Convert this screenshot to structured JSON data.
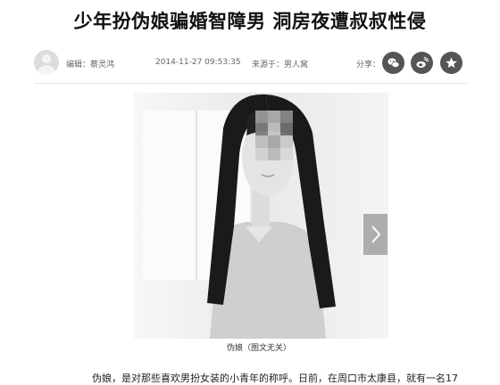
{
  "article": {
    "title": "少年扮伪娘骗婚智障男 洞房夜遭叔叔性侵",
    "editor": "编辑：蔡灵鸿",
    "datetime": "2014-11-27 09:53:35",
    "source": "来源于：男人窝",
    "share_label": "分享：",
    "share_buttons": [
      "wechat-icon",
      "weibo-icon",
      "favorite-star-icon"
    ],
    "image_caption": "伪娘（图文无关）",
    "body_first_line": "伪娘，是对那些喜欢男扮女装的小青年的称呼。日前，在周口市太康县，就有一名17"
  },
  "colors": {
    "share_button_bg": "#555555",
    "title": "#111111",
    "meta_text": "#666666"
  }
}
